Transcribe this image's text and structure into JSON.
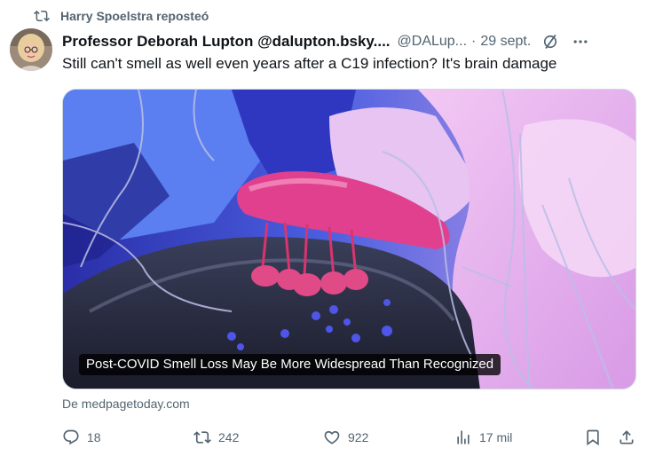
{
  "repost": {
    "text": "Harry Spoelstra reposteó",
    "icon": "repost-icon"
  },
  "author": {
    "name": "Professor Deborah Lupton @dalupton.bsky....",
    "handle": "@DALup...",
    "separator": "·",
    "date": "29 sept."
  },
  "tweet": {
    "text": "Still can't smell as well even years after a C19 infection? It's brain damage"
  },
  "card": {
    "title": "Post-COVID Smell Loss May Be More Widespread Than Recognized",
    "source": "De medpagetoday.com"
  },
  "actions": {
    "replies": "18",
    "reposts": "242",
    "likes": "922",
    "views": "17 mil"
  },
  "colors": {
    "muted": "#536471",
    "text": "#0f1419",
    "border": "#cfd9de"
  }
}
